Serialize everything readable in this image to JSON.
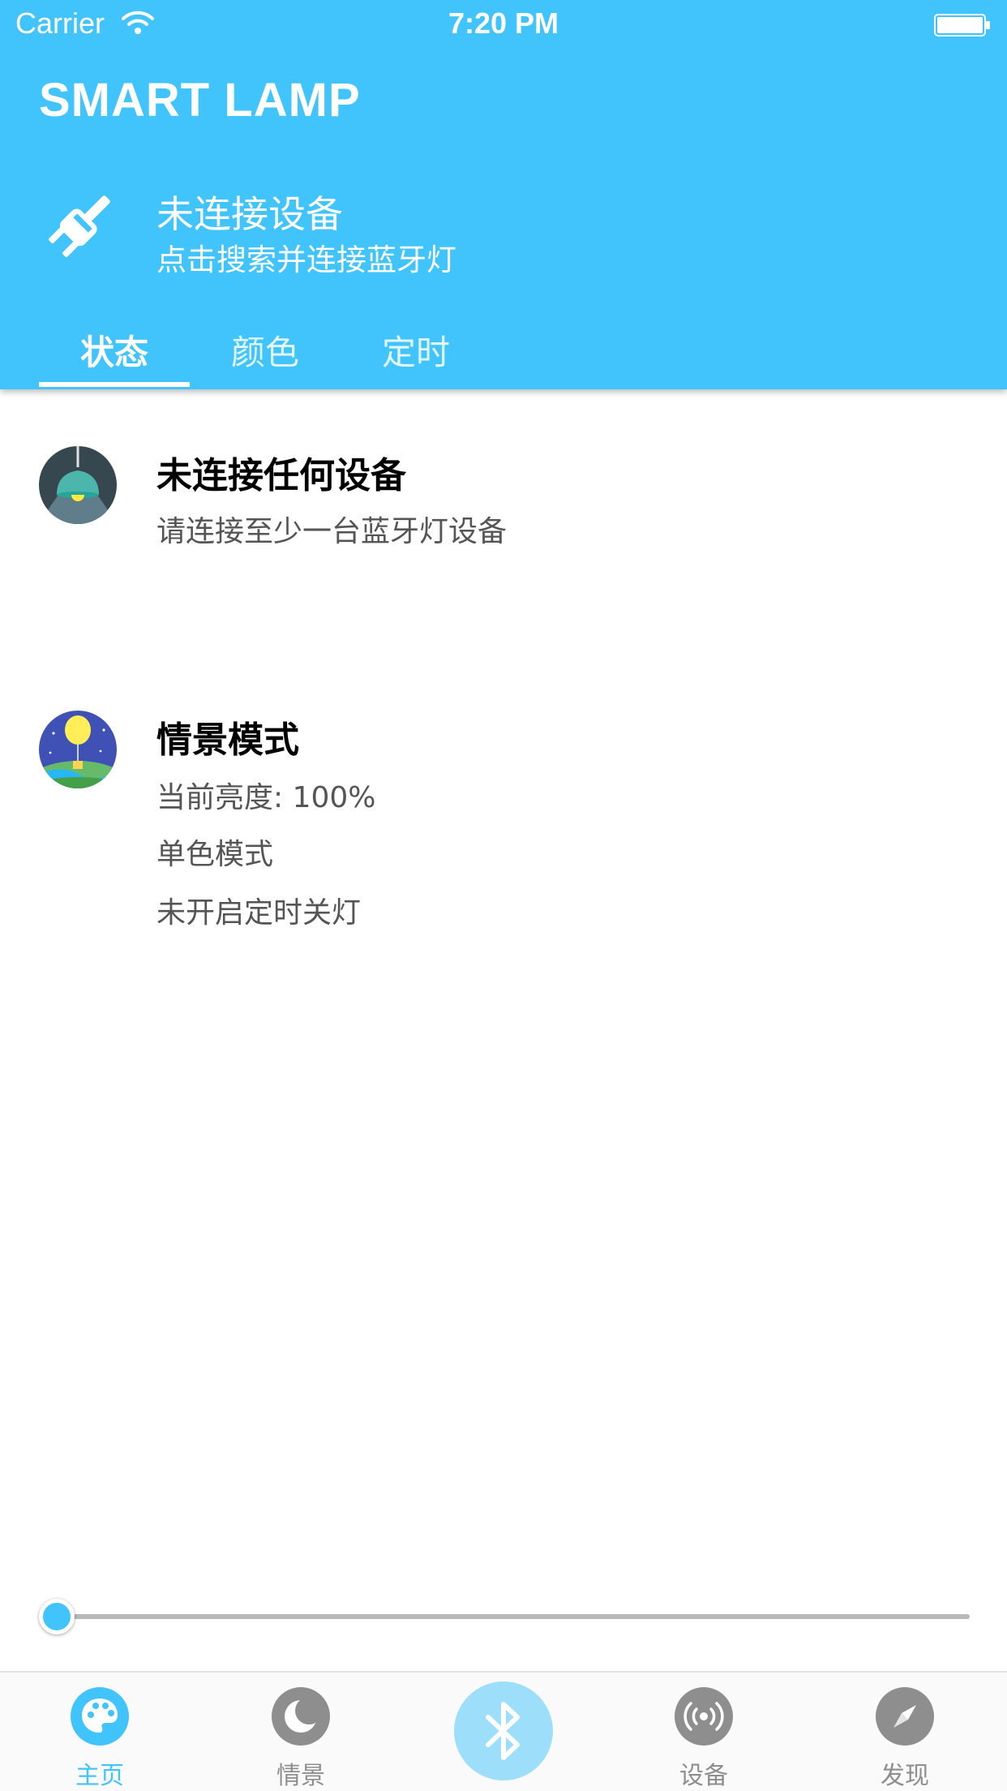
{
  "status_bar": {
    "carrier": "Carrier",
    "time": "7:20 PM"
  },
  "app": {
    "title": "SMART LAMP"
  },
  "connection": {
    "icon": "plug-icon",
    "title": "未连接设备",
    "subtitle": "点击搜索并连接蓝牙灯"
  },
  "tabs": [
    {
      "label": "状态",
      "active": true
    },
    {
      "label": "颜色",
      "active": false
    },
    {
      "label": "定时",
      "active": false
    }
  ],
  "device_status": {
    "icon": "lamp-icon",
    "title": "未连接任何设备",
    "description": "请连接至少一台蓝牙灯设备"
  },
  "scene_mode": {
    "icon": "balloon-scene-icon",
    "title": "情景模式",
    "brightness": "当前亮度: 100%",
    "color_mode": "单色模式",
    "timer": "未开启定时关灯"
  },
  "slider": {
    "value": 0
  },
  "tabbar": [
    {
      "label": "主页",
      "icon": "palette-icon",
      "active": true
    },
    {
      "label": "情景",
      "icon": "moon-icon",
      "active": false
    },
    {
      "label": "",
      "icon": "bluetooth-icon",
      "active": false
    },
    {
      "label": "设备",
      "icon": "broadcast-icon",
      "active": false
    },
    {
      "label": "发现",
      "icon": "compass-icon",
      "active": false
    }
  ],
  "colors": {
    "primary": "#40c4fb",
    "bluetooth_button": "#9ddffb",
    "inactive": "#8e8e8e"
  }
}
